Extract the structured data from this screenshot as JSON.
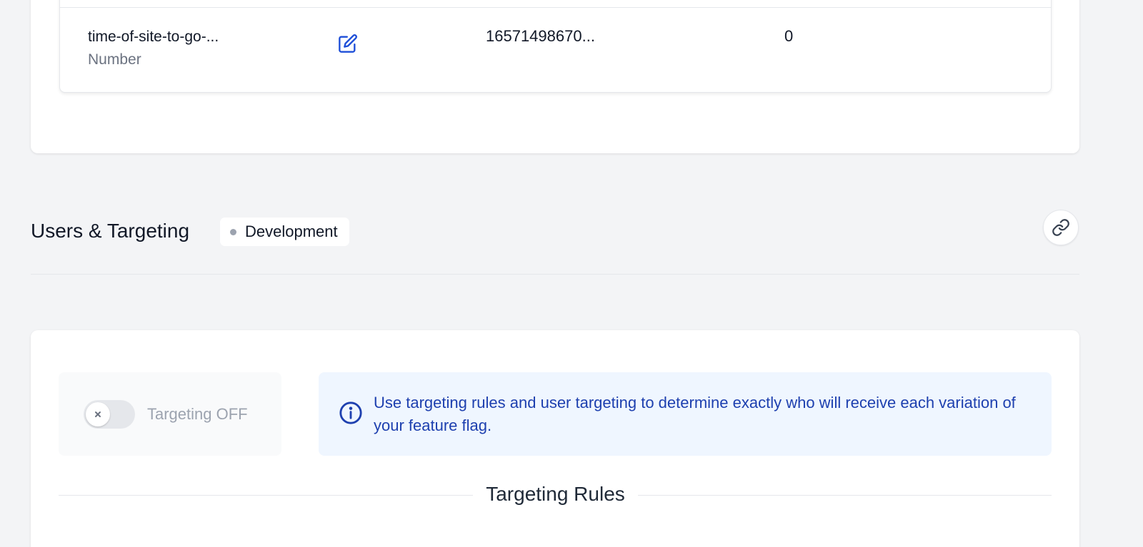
{
  "variables_table": {
    "row": {
      "key": "time-of-site-to-go-...",
      "type": "Number",
      "value": "16571498670...",
      "count": "0"
    }
  },
  "targeting_section": {
    "title": "Users & Targeting",
    "environment": "Development",
    "link_icon": "link-icon"
  },
  "targeting_card": {
    "toggle_label": "Targeting OFF",
    "toggle_on": false,
    "info_text": "Use targeting rules and user targeting to determine exactly who will receive each variation of your feature flag.",
    "rules_heading": "Targeting Rules"
  },
  "colors": {
    "accent": "#1d4ed8",
    "info_bg": "#eff6ff",
    "info_text": "#1e40af",
    "background": "#f3f4f6"
  }
}
